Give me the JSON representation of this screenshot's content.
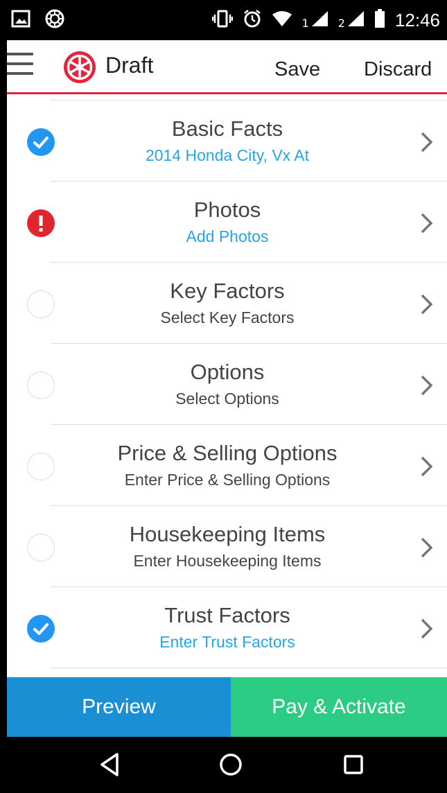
{
  "status_bar": {
    "time": "12:46",
    "sim1": "1",
    "sim2": "2",
    "icons": [
      "picture-icon",
      "steering-wheel-icon",
      "vibrate-icon",
      "alarm-icon",
      "wifi-icon",
      "signal-icon",
      "signal-icon",
      "battery-icon"
    ]
  },
  "app_bar": {
    "title": "Draft",
    "save_label": "Save",
    "discard_label": "Discard",
    "accent": "#e3263b"
  },
  "sections": [
    {
      "title": "Basic Facts",
      "subtitle": "2014 Honda City, Vx At",
      "status": "done",
      "subtitle_style": "blue"
    },
    {
      "title": "Photos",
      "subtitle": "Add Photos",
      "status": "error",
      "subtitle_style": "blue"
    },
    {
      "title": "Key Factors",
      "subtitle": "Select Key Factors",
      "status": "empty",
      "subtitle_style": "dark"
    },
    {
      "title": "Options",
      "subtitle": "Select Options",
      "status": "empty",
      "subtitle_style": "dark"
    },
    {
      "title": "Price & Selling Options",
      "subtitle": "Enter Price & Selling Options",
      "status": "empty",
      "subtitle_style": "dark"
    },
    {
      "title": "Housekeeping Items",
      "subtitle": "Enter Housekeeping Items",
      "status": "empty",
      "subtitle_style": "dark"
    },
    {
      "title": "Trust Factors",
      "subtitle": "Enter Trust Factors",
      "status": "done",
      "subtitle_style": "blue"
    }
  ],
  "buttons": {
    "preview": "Preview",
    "pay_activate": "Pay & Activate",
    "preview_color": "#1a8fd4",
    "pay_color": "#2dcc84"
  },
  "colors": {
    "done": "#2196f3",
    "error": "#e0262d",
    "link_blue": "#29a3e8"
  }
}
